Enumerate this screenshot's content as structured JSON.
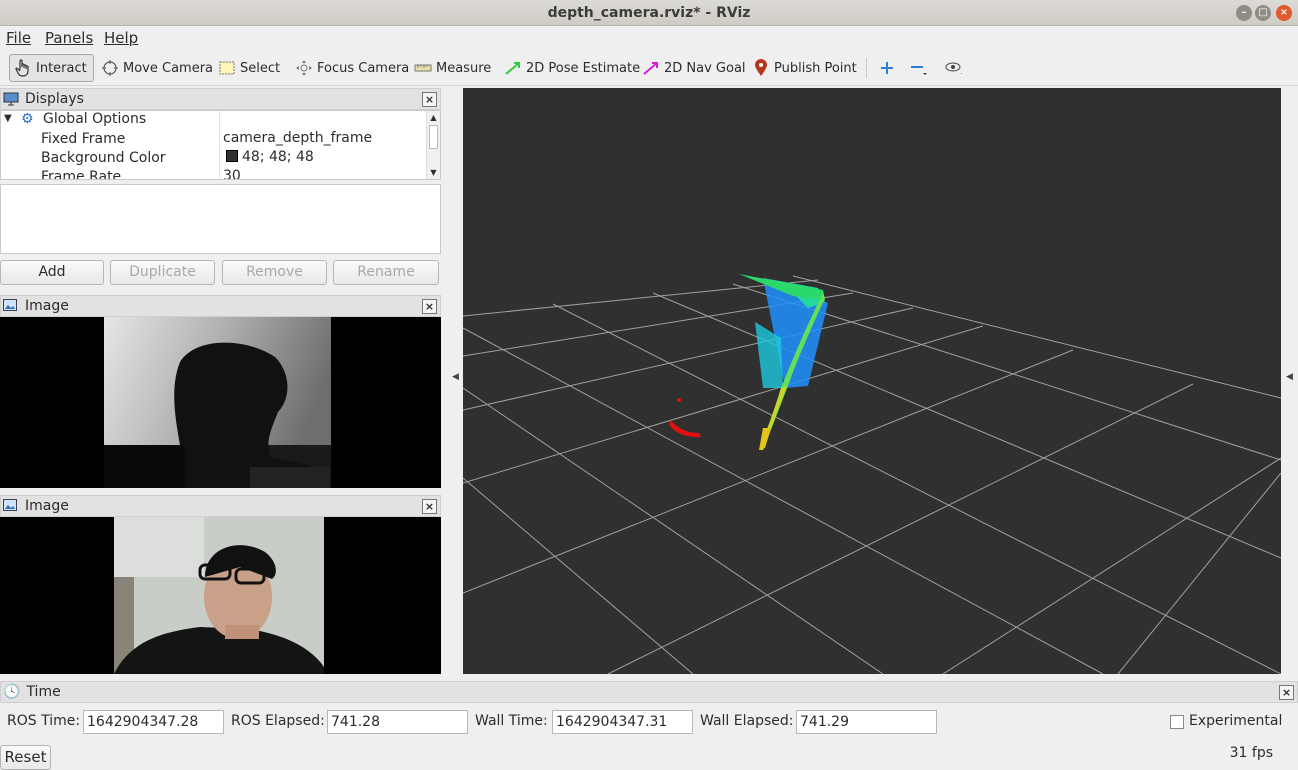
{
  "window": {
    "title": "depth_camera.rviz* - RViz"
  },
  "menu": [
    "File",
    "Panels",
    "Help"
  ],
  "toolbar": {
    "tools": [
      {
        "label": "Interact",
        "icon": "hand-icon"
      },
      {
        "label": "Move Camera",
        "icon": "move-camera-icon"
      },
      {
        "label": "Select",
        "icon": "select-icon"
      },
      {
        "label": "Focus Camera",
        "icon": "focus-camera-icon"
      },
      {
        "label": "Measure",
        "icon": "ruler-icon"
      },
      {
        "label": "2D Pose Estimate",
        "icon": "green-arrow-icon"
      },
      {
        "label": "2D Nav Goal",
        "icon": "magenta-arrow-icon"
      },
      {
        "label": "Publish Point",
        "icon": "map-pin-icon"
      }
    ],
    "accent_colors": {
      "pose": "#2ecc40",
      "nav": "#d61ed6",
      "pin": "#b5361a",
      "plus": "#2a7fd4"
    }
  },
  "displays": {
    "title": "Displays",
    "global_options": "Global Options",
    "rows": [
      {
        "name": "Fixed Frame",
        "value": "camera_depth_frame"
      },
      {
        "name": "Background Color",
        "value": "48; 48; 48"
      },
      {
        "name": "Frame Rate",
        "value": "30"
      }
    ],
    "bg_swatch": "#303030",
    "buttons": {
      "add": "Add",
      "duplicate": "Duplicate",
      "remove": "Remove",
      "rename": "Rename"
    }
  },
  "image_panels": [
    {
      "title": "Image"
    },
    {
      "title": "Image"
    }
  ],
  "time": {
    "title": "Time",
    "ros_time_label": "ROS Time:",
    "ros_time": "1642904347.28",
    "ros_elapsed_label": "ROS Elapsed:",
    "ros_elapsed": "741.28",
    "wall_time_label": "Wall Time:",
    "wall_time": "1642904347.31",
    "wall_elapsed_label": "Wall Elapsed:",
    "wall_elapsed": "741.29",
    "experimental": "Experimental",
    "reset": "Reset",
    "fps": "31 fps"
  }
}
